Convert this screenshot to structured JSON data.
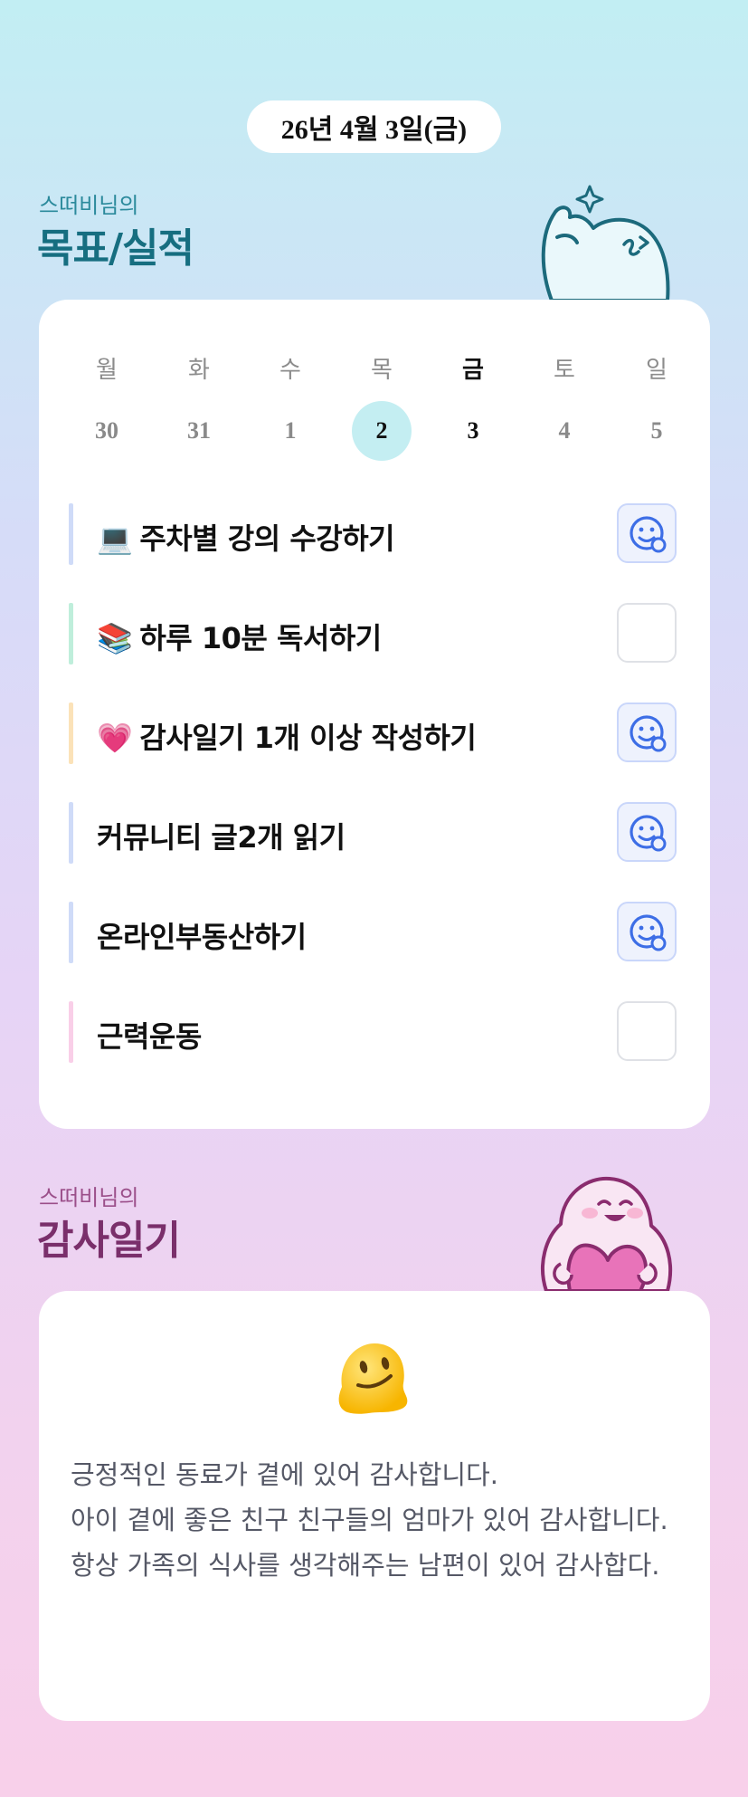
{
  "header": {
    "date": "26년 4월 3일(금)"
  },
  "goals_section": {
    "subtitle": "스떠비님의",
    "title": "목표/실적"
  },
  "calendar": {
    "weekdays": [
      "월",
      "화",
      "수",
      "목",
      "금",
      "토",
      "일"
    ],
    "dates": [
      "30",
      "31",
      "1",
      "2",
      "3",
      "4",
      "5"
    ],
    "selected_index": 3,
    "current_index": 4
  },
  "goals": [
    {
      "emoji": "💻",
      "label": "주차별 강의 수강하기",
      "done": true,
      "color": "#cfdbf8"
    },
    {
      "emoji": "📚",
      "label": "하루 10분 독서하기",
      "done": false,
      "color": "#bfeedb"
    },
    {
      "emoji": "💗",
      "label": "감사일기 1개 이상 작성하기",
      "done": true,
      "color": "#fbe2b8"
    },
    {
      "emoji": "",
      "label": "커뮤니티 글2개 읽기",
      "done": true,
      "color": "#cfdbf8"
    },
    {
      "emoji": "",
      "label": "온라인부동산하기",
      "done": true,
      "color": "#cfdbf8"
    },
    {
      "emoji": "",
      "label": "근력운동",
      "done": false,
      "color": "#f9cfe8"
    }
  ],
  "diary_section": {
    "subtitle": "스떠비님의",
    "title": "감사일기"
  },
  "diary": {
    "emoji": "melting-face",
    "text": "긍정적인 동료가 곁에 있어 감사합니다.\n아이 곁에 좋은 친구 친구들의 엄마가 있어 감사합니다.\n항상 가족의 식사를 생각해주는 남편이 있어 감사합다."
  },
  "colors": {
    "accent": "#3d6ee6",
    "teal": "#166e80",
    "plum": "#7a2f6b"
  }
}
